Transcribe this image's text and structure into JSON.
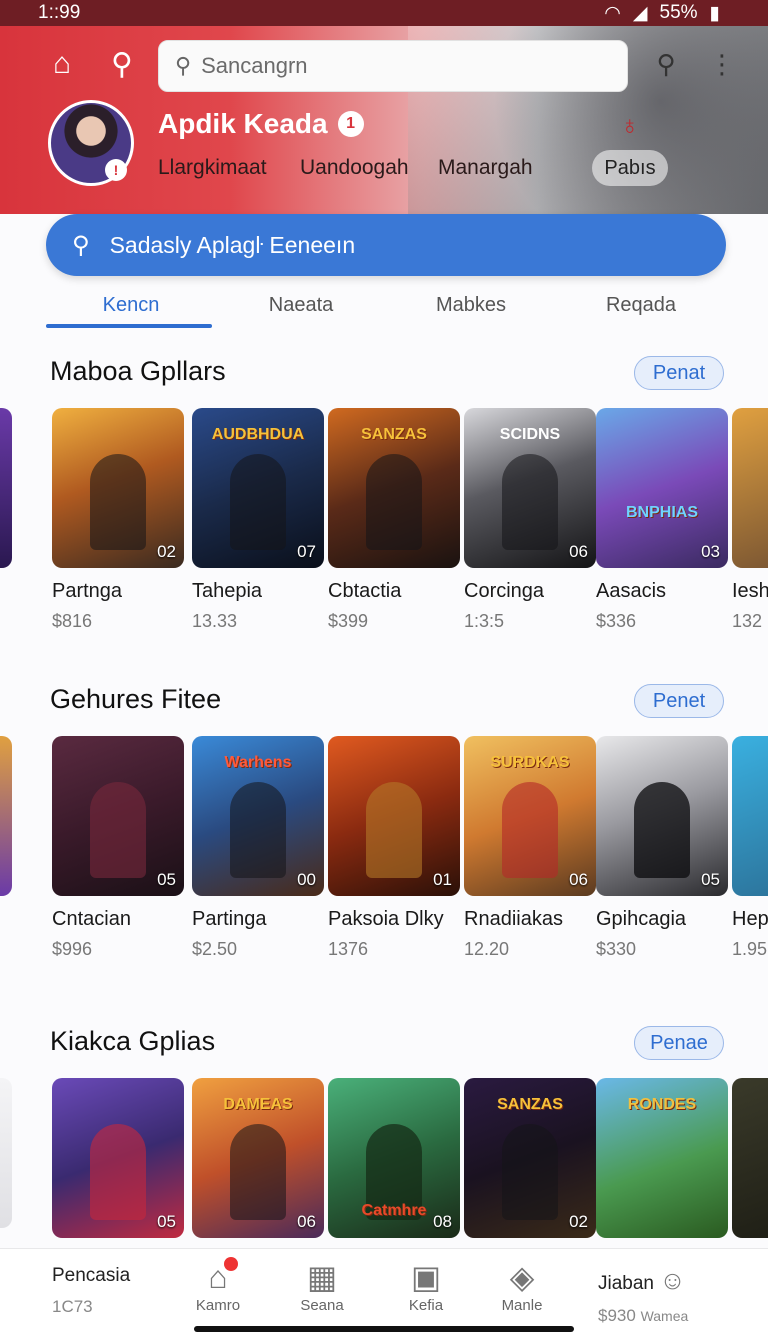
{
  "status": {
    "time": "1::99",
    "battery": "55%",
    "right_label": "ꟷꟷ"
  },
  "header": {
    "search_placeholder": "Sancangrn",
    "username": "Apdik Keada",
    "user_badge": "1",
    "stats": [
      "Llargkimaat",
      "Uandoogah",
      "Manargah"
    ],
    "pill": "Pabıs"
  },
  "big_search": {
    "placeholder": "Sadasly Aplagŀ Eeneeın"
  },
  "tabs": [
    "Kencn",
    "Naeata",
    "Mabkes",
    "Reqada"
  ],
  "sections": [
    {
      "title": "Maboa Gpllars",
      "button": "Penat",
      "items": [
        {
          "name": "Partnga",
          "price": "$816",
          "num": "02",
          "logo": ""
        },
        {
          "name": "Tahepia",
          "price": "13.33",
          "num": "07",
          "logo": "AUDBHDUA"
        },
        {
          "name": "Cbtactia",
          "price": "$399",
          "num": "",
          "logo": "SANZAS"
        },
        {
          "name": "Corcinga",
          "price": "1:3:5",
          "num": "06",
          "logo": "SCIDNS"
        },
        {
          "name": "Aasacis",
          "price": "$336",
          "num": "03",
          "logo": "BNPHIAS"
        }
      ],
      "edge_right": {
        "name": "Iesh",
        "price": "132"
      }
    },
    {
      "title": "Gehures Fitee",
      "button": "Penet",
      "items": [
        {
          "name": "Cntacian",
          "price": "$996",
          "num": "05",
          "logo": ""
        },
        {
          "name": "Partinga",
          "price": "$2.50",
          "num": "00",
          "logo": "Warhens"
        },
        {
          "name": "Paksoia Dlky",
          "price": "1376",
          "num": "01",
          "logo": ""
        },
        {
          "name": "Rnadiiakas",
          "price": "12.20",
          "num": "06",
          "logo": "SURDKAS"
        },
        {
          "name": "Gpihcagia",
          "price": "$330",
          "num": "05",
          "logo": ""
        }
      ],
      "edge_right": {
        "name": "Hep",
        "price": "1.95"
      }
    },
    {
      "title": "Kiakca Gplias",
      "button": "Penae",
      "items": [
        {
          "name": "",
          "price": "",
          "num": "05",
          "logo": ""
        },
        {
          "name": "",
          "price": "",
          "num": "06",
          "logo": "DAMEAS"
        },
        {
          "name": "",
          "price": "",
          "num": "08",
          "logo": "Catmhre"
        },
        {
          "name": "",
          "price": "",
          "num": "02",
          "logo": "SANZAS"
        },
        {
          "name": "",
          "price": "",
          "num": "",
          "logo": "RONDES"
        }
      ]
    }
  ],
  "bottom_nav": {
    "left": {
      "title": "Pencasia",
      "sub": "1C73"
    },
    "right": {
      "title": "Jiaban",
      "sub": "$930",
      "extra": "Wamea"
    },
    "items": [
      "Kamro",
      "Seana",
      "Kefia",
      "Manle"
    ]
  },
  "colors": {
    "header_red": "#d8343c",
    "accent_blue": "#3a78d6"
  }
}
